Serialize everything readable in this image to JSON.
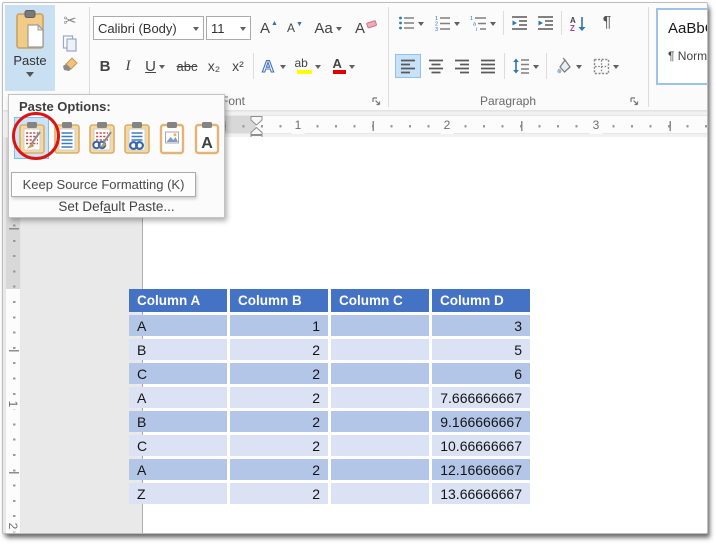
{
  "ribbon": {
    "clipboard": {
      "paste_label": "Paste"
    },
    "font": {
      "group_label": "Font",
      "font_name": "Calibri (Body)",
      "font_size": "11",
      "grow": "A",
      "shrink": "A",
      "change_case": "Aa",
      "clear": "A",
      "bold": "B",
      "italic": "I",
      "underline": "U",
      "strikethrough": "abc",
      "subscript": "x₂",
      "superscript": "x²",
      "effects": "A",
      "highlight": "ab",
      "font_color": "A"
    },
    "paragraph": {
      "group_label": "Paragraph",
      "sort_a": "A",
      "sort_z": "Z",
      "pilcrow": "¶"
    },
    "styles": {
      "preview": "AaBbCc",
      "name": "¶ Normal"
    }
  },
  "paste_menu": {
    "title": "Paste Options:",
    "options": [
      "keep-source-formatting",
      "use-destination-styles",
      "link-and-keep-source-formatting",
      "link-and-use-destination-styles",
      "picture",
      "keep-text-only"
    ],
    "keep_text_letter": "A",
    "tooltip": "Keep Source Formatting (K)",
    "set_default_pre": "Set Def",
    "set_default_accel": "a",
    "set_default_post": "ult Paste..."
  },
  "ruler": {
    "horizontal": [
      {
        "n": "1",
        "pos": 154
      },
      {
        "n": "2",
        "pos": 303
      },
      {
        "n": "3",
        "pos": 452
      }
    ],
    "vertical": [
      {
        "n": "1",
        "pos": 266
      },
      {
        "n": "2",
        "pos": 388
      }
    ]
  },
  "document": {
    "table": {
      "headers": [
        "Column A",
        "Column B",
        "Column C",
        "Column D"
      ],
      "rows": [
        [
          "A",
          "1",
          "",
          "3"
        ],
        [
          "B",
          "2",
          "",
          "5"
        ],
        [
          "C",
          "2",
          "",
          "6"
        ],
        [
          "A",
          "2",
          "",
          "7.666666667"
        ],
        [
          "B",
          "2",
          "",
          "9.166666667"
        ],
        [
          "C",
          "2",
          "",
          "10.66666667"
        ],
        [
          "A",
          "2",
          "",
          "12.16666667"
        ],
        [
          "Z",
          "2",
          "",
          "13.66666667"
        ]
      ]
    }
  },
  "colors": {
    "table_header_bg": "#4472C4",
    "band_dark": "#B4C6E7",
    "band_light": "#DAE2F3",
    "annotation_red": "#DC1512",
    "selection_blue": "#C9DFF2"
  }
}
